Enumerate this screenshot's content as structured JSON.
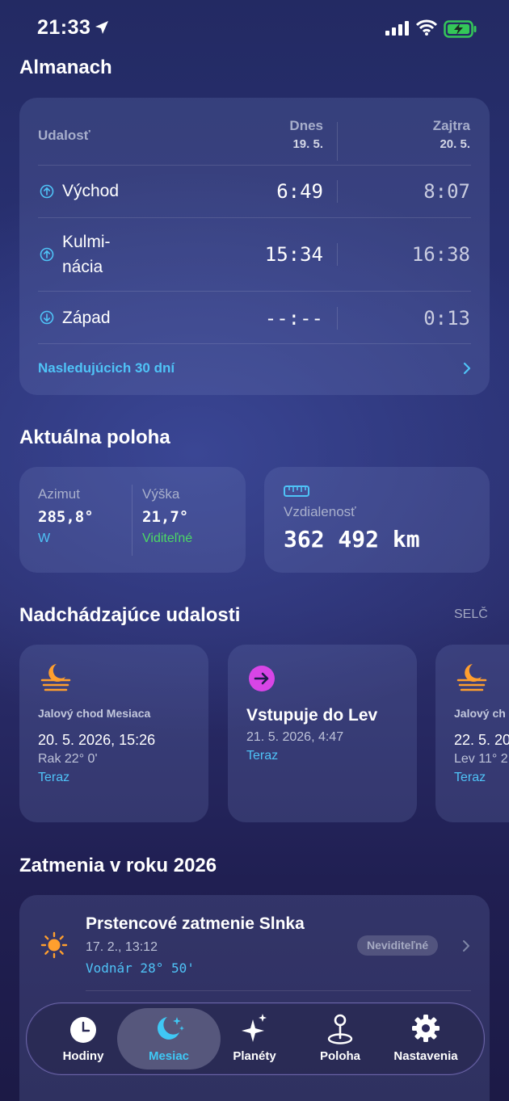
{
  "status_bar": {
    "time": "21:33"
  },
  "almanac": {
    "title": "Almanach",
    "col_event": "Udalosť",
    "col_today": "Dnes",
    "col_today_date": "19. 5.",
    "col_tomorrow": "Zajtra",
    "col_tomorrow_date": "20. 5.",
    "rows": [
      {
        "label": "Východ",
        "today": "6:49",
        "tomorrow": "8:07"
      },
      {
        "label_line1": "Kulmi-",
        "label_line2": "nácia",
        "today": "15:34",
        "tomorrow": "16:38"
      },
      {
        "label": "Západ",
        "today": "--:--",
        "tomorrow": "0:13"
      }
    ],
    "next_days_link": "Nasledujúcich 30 dní"
  },
  "position": {
    "title": "Aktuálna poloha",
    "azimuth_label": "Azimut",
    "azimuth_value": "285,8°",
    "azimuth_dir": "W",
    "altitude_label": "Výška",
    "altitude_value": "21,7°",
    "altitude_status": "Viditeľné",
    "distance_label": "Vzdialenosť",
    "distance_value": "362 492 km"
  },
  "upcoming": {
    "title": "Nadchádzajúce udalosti",
    "all_link": "SELČ",
    "events": [
      {
        "kind": "Jalový chod Mesiaca",
        "date": "20. 5. 2026, 15:26",
        "detail": "Rak 22° 0'",
        "link": "Teraz"
      },
      {
        "title": "Vstupuje do Lev",
        "date": "21. 5. 2026, 4:47",
        "link": "Teraz"
      },
      {
        "kind": "Jalový ch",
        "date": "22. 5. 20",
        "detail": "Lev 11° 2",
        "link": "Teraz"
      }
    ]
  },
  "eclipses": {
    "title": "Zatmenia v roku 2026",
    "items": [
      {
        "name": "Prstencové zatmenie Slnka",
        "date": "17. 2., 13:12",
        "sign": "Vodnár 28° 50'",
        "badge": "Neviditeľné"
      }
    ]
  },
  "tabbar": {
    "tabs": [
      {
        "label": "Hodiny"
      },
      {
        "label": "Mesiac"
      },
      {
        "label": "Planéty"
      },
      {
        "label": "Poloha"
      },
      {
        "label": "Nastavenia"
      }
    ]
  },
  "colors": {
    "accent": "#4fc3f7",
    "visible_green": "#4cd964",
    "sun_orange": "#ff9f2e",
    "event_magenta": "#d845e6"
  }
}
